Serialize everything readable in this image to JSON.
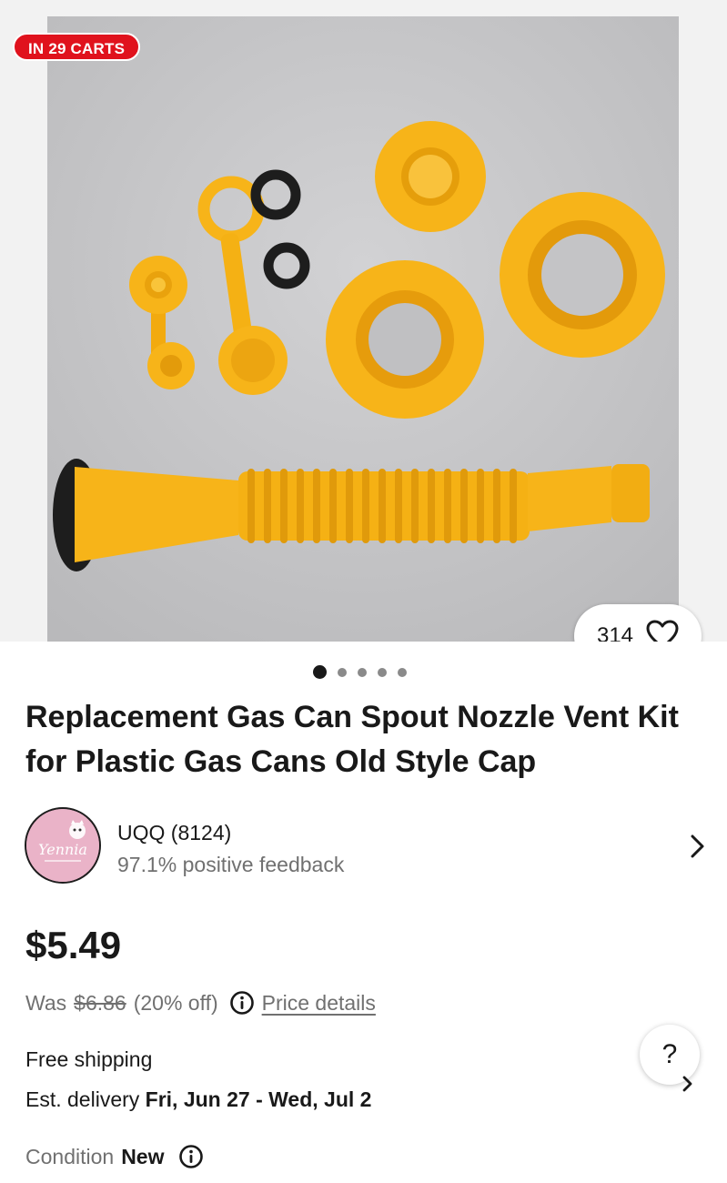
{
  "badge": {
    "carts": "IN 29 CARTS"
  },
  "watchers": {
    "count": "314"
  },
  "gallery": {
    "total": 5,
    "active": 0
  },
  "product": {
    "title": "Replacement Gas Can Spout Nozzle Vent Kit for Plastic Gas Cans Old Style Cap"
  },
  "seller": {
    "name": "UQQ (8124)",
    "feedback": "97.1% positive feedback",
    "avatar_text": "Yennia"
  },
  "pricing": {
    "price": "$5.49",
    "was_label": "Was",
    "was_price": "$6.86",
    "discount": "(20% off)",
    "details_link": "Price details"
  },
  "shipping": {
    "label": "Free shipping",
    "delivery_label": "Est. delivery",
    "delivery_dates": "Fri, Jun 27 - Wed, Jul 2"
  },
  "help": {
    "label": "?"
  },
  "condition": {
    "label": "Condition",
    "value": "New"
  },
  "colors": {
    "badge": "#e0121d",
    "text": "#191919",
    "muted": "#707070",
    "plastic": "#f7b419"
  }
}
